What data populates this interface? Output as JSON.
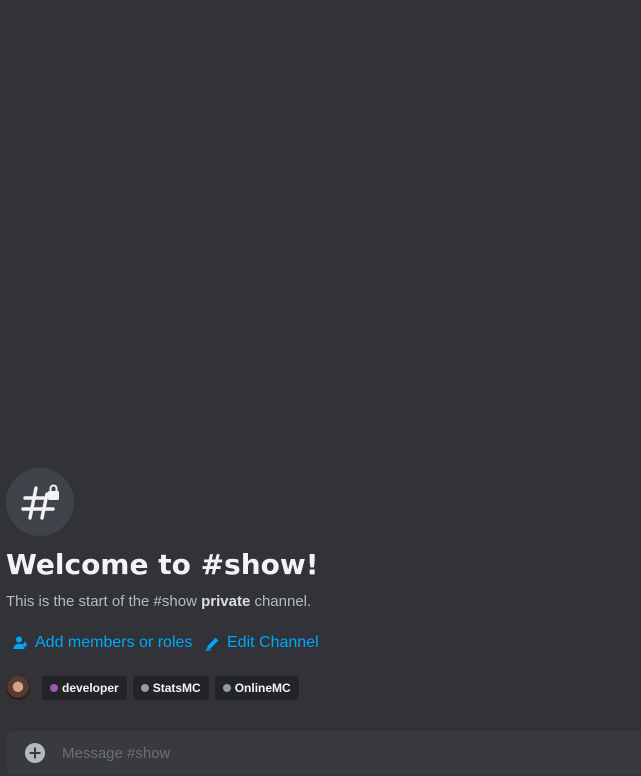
{
  "channel": {
    "icon": "hashtag-lock-icon",
    "welcome_title": "Welcome to #show!",
    "description_prefix": "This is the start of the #show ",
    "description_bold": "private",
    "description_suffix": " channel."
  },
  "actions": {
    "add_members": {
      "label": "Add members or roles",
      "icon": "person-add-icon"
    },
    "edit_channel": {
      "label": "Edit Channel",
      "icon": "pencil-icon"
    }
  },
  "roles": [
    {
      "name": "developer",
      "color": "#9b59b6"
    },
    {
      "name": "StatsMC",
      "color": "#949ba4"
    },
    {
      "name": "OnlineMC",
      "color": "#949ba4"
    }
  ],
  "composer": {
    "placeholder": "Message #show",
    "attach_icon": "plus-circle-icon"
  },
  "colors": {
    "background": "#313338",
    "link": "#00a8fc",
    "composer_bg": "#383a40"
  }
}
